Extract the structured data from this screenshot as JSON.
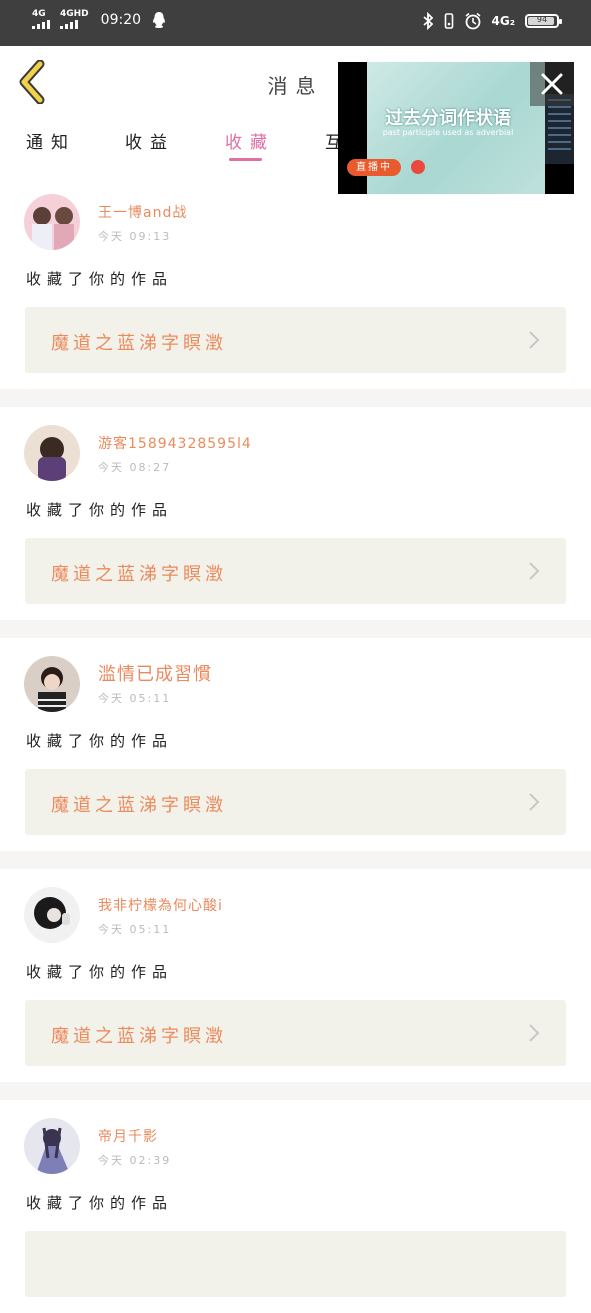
{
  "status_bar": {
    "sim1": "4G",
    "sim2": "4GHD",
    "time": "09:20",
    "net": "4G₂",
    "battery": "94"
  },
  "header": {
    "title": "消息"
  },
  "tabs": [
    {
      "label": "通知",
      "active": false
    },
    {
      "label": "收益",
      "active": false
    },
    {
      "label": "收藏",
      "active": true
    },
    {
      "label": "互",
      "active": false
    }
  ],
  "pip": {
    "title": "过去分词作状语",
    "subtitle": "past participle used as adverbial",
    "live_label": "直播中"
  },
  "feed": [
    {
      "user": "王一博and战",
      "time": "今天 09:13",
      "action": "收藏了你的作品",
      "work": "魔道之蓝涕字瞑澂",
      "avatar_color": "#f2b6c5"
    },
    {
      "user": "游客15894328595l4",
      "time": "今天 08:27",
      "action": "收藏了你的作品",
      "work": "魔道之蓝涕字瞑澂",
      "avatar_color": "#c9b6a6"
    },
    {
      "user": "滥情已成習慣",
      "time": "今天 05:11",
      "action": "收藏了你的作品",
      "work": "魔道之蓝涕字瞑澂",
      "avatar_color": "#b7a59a"
    },
    {
      "user": "我非柠檬為何心酸i",
      "time": "今天 05:11",
      "action": "收藏了你的作品",
      "work": "魔道之蓝涕字瞑澂",
      "avatar_color": "#9a9a9a"
    },
    {
      "user": "帝月千影",
      "time": "今天 02:39",
      "action": "收藏了你的作品",
      "work": "",
      "avatar_color": "#8b8fb8"
    }
  ]
}
